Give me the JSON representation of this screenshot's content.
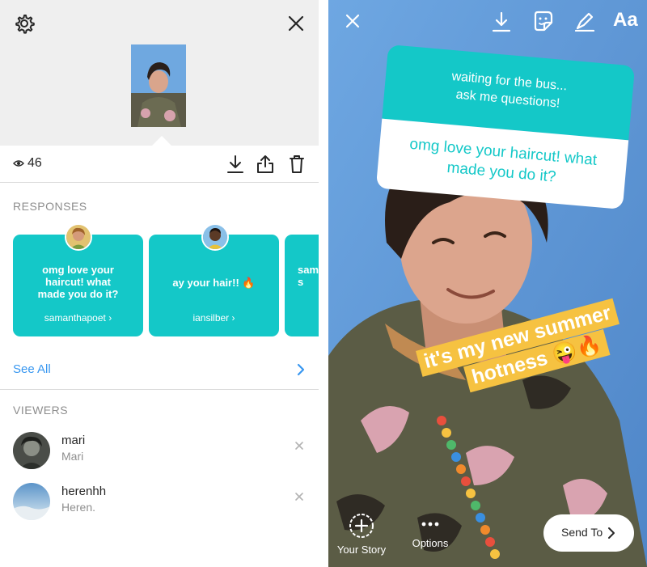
{
  "left": {
    "view_count": "46",
    "responses": {
      "section_label": "RESPONSES",
      "cards": [
        {
          "text": "omg love your haircut! what made you do it?",
          "user": "samanthapoet"
        },
        {
          "text": "ay your hair!! 🔥",
          "user": "iansilber"
        },
        {
          "text": "sam te s",
          "user": ""
        }
      ],
      "see_all": "See All"
    },
    "viewers": {
      "section_label": "VIEWERS",
      "list": [
        {
          "username": "mari",
          "full_name": "Mari"
        },
        {
          "username": "herenhh",
          "full_name": "Heren."
        }
      ]
    }
  },
  "right": {
    "text_tool": "Aa",
    "question_sticker": {
      "prompt_line1": "waiting for the bus...",
      "prompt_line2": "ask me questions!",
      "response_line1": "omg love your haircut! what",
      "response_line2": "made you do it?"
    },
    "caption": {
      "line1": "it's my new summer",
      "line2": "hotness 😜🔥"
    },
    "bottom": {
      "your_story": "Your Story",
      "options": "Options",
      "send_to": "Send To"
    }
  },
  "colors": {
    "accent_teal": "#14c8c8",
    "link_blue": "#3897f0",
    "caption_yellow": "#f6c241",
    "sky_blue": "#6aa4df"
  },
  "icons": [
    "gear-icon",
    "close-icon",
    "eye-icon",
    "download-icon",
    "share-icon",
    "trash-icon",
    "chevron-right-icon",
    "sticker-icon",
    "pen-icon",
    "add-story-icon",
    "more-icon"
  ]
}
